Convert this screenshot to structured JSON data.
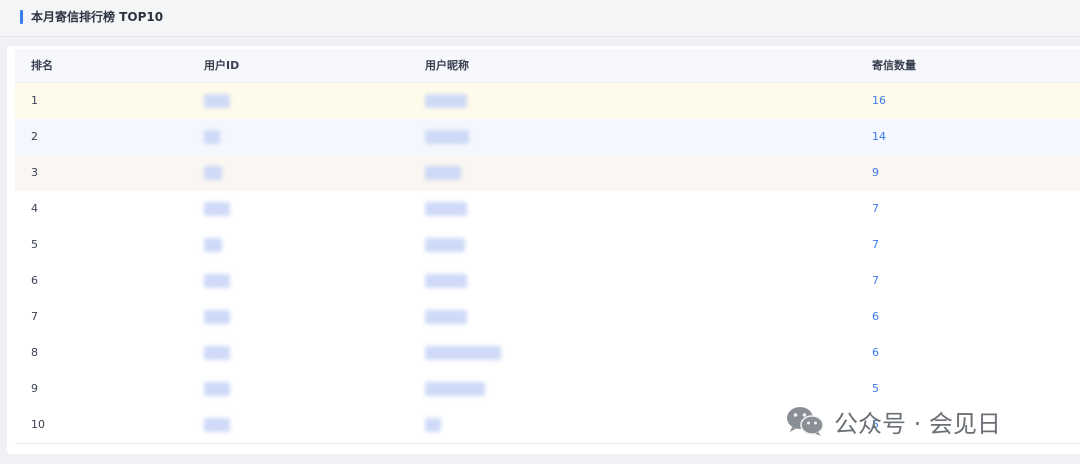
{
  "section": {
    "title": "本月寄信排行榜 TOP10",
    "accent_color": "#3b7bf0"
  },
  "table": {
    "headers": [
      "排名",
      "用户ID",
      "用户昵称",
      "寄信数量"
    ],
    "rows": [
      {
        "rank": "1",
        "count": "16",
        "highlight": "#fffbeb"
      },
      {
        "rank": "2",
        "count": "14",
        "highlight": "#f4f7fd"
      },
      {
        "rank": "3",
        "count": "9",
        "highlight": "#faf6f2"
      },
      {
        "rank": "4",
        "count": "7",
        "highlight": "#ffffff"
      },
      {
        "rank": "5",
        "count": "7",
        "highlight": "#ffffff"
      },
      {
        "rank": "6",
        "count": "7",
        "highlight": "#ffffff"
      },
      {
        "rank": "7",
        "count": "6",
        "highlight": "#ffffff"
      },
      {
        "rank": "8",
        "count": "6",
        "highlight": "#ffffff"
      },
      {
        "rank": "9",
        "count": "5",
        "highlight": "#ffffff"
      },
      {
        "rank": "10",
        "count": "5",
        "highlight": "#ffffff"
      }
    ],
    "count_color": "#3b7bf0"
  },
  "watermark": {
    "icon": "wechat-icon",
    "text": "公众号 · 会见日"
  }
}
